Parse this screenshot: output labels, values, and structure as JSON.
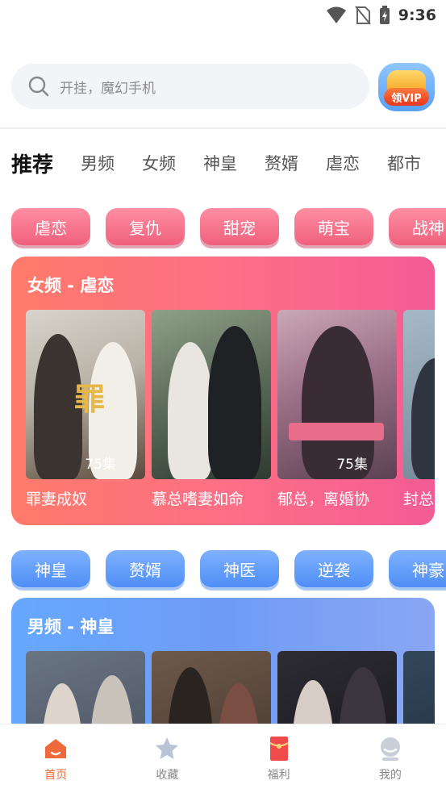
{
  "status_bar": {
    "time": "9:36",
    "icons": [
      "wifi-icon",
      "no-sim-icon",
      "battery-charging-icon"
    ]
  },
  "search": {
    "placeholder": "开挂，魔幻手机",
    "icon": "search-icon"
  },
  "vip_badge": {
    "label": "领VIP"
  },
  "category_tabs": [
    "推荐",
    "男频",
    "女频",
    "神皇",
    "赘婿",
    "虐恋",
    "都市"
  ],
  "active_tab_index": 0,
  "female_chips": [
    "虐恋",
    "复仇",
    "甜宠",
    "萌宝",
    "战神"
  ],
  "female_section": {
    "title": "女频 - 虐恋",
    "items": [
      {
        "title": "罪妻成奴",
        "episodes": "75集"
      },
      {
        "title": "慕总嗜妻如命",
        "episodes": ""
      },
      {
        "title": "郁总，离婚协",
        "episodes": "75集"
      },
      {
        "title": "封总",
        "episodes": ""
      }
    ]
  },
  "male_chips": [
    "神皇",
    "赘婿",
    "神医",
    "逆袭",
    "神豪"
  ],
  "male_section": {
    "title": "男频 - 神皇"
  },
  "bottom_nav": [
    {
      "label": "首页",
      "icon": "home-icon"
    },
    {
      "label": "收藏",
      "icon": "star-icon"
    },
    {
      "label": "福利",
      "icon": "red-envelope-icon"
    },
    {
      "label": "我的",
      "icon": "profile-icon"
    }
  ],
  "colors": {
    "accent": "#ef6a3a",
    "female_gradient_start": "#ff7a6a",
    "female_gradient_end": "#f35c95",
    "male_gradient_start": "#66a8ff",
    "male_gradient_end": "#8aa6f4"
  }
}
